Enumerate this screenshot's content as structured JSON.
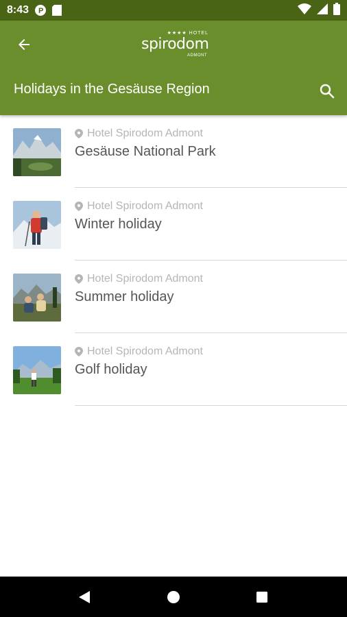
{
  "status_bar": {
    "time": "8:43",
    "icons": [
      "p-icon",
      "sd-card-icon",
      "wifi-icon",
      "signal-icon",
      "battery-icon"
    ]
  },
  "app_bar": {
    "logo": {
      "stars": "★★★★ HOTEL",
      "brand": "spirodom",
      "sub": "ADMONT"
    },
    "title": "Holidays in the Gesäuse Region",
    "back_icon": "arrow-left-icon",
    "search_icon": "search-icon"
  },
  "items": [
    {
      "location": "Hotel Spirodom Admont",
      "title": "Gesäuse National Park"
    },
    {
      "location": "Hotel Spirodom Admont",
      "title": "Winter holiday"
    },
    {
      "location": "Hotel Spirodom Admont",
      "title": "Summer holiday"
    },
    {
      "location": "Hotel Spirodom Admont",
      "title": "Golf holiday"
    }
  ],
  "nav_bar": {
    "buttons": [
      "back-triangle-icon",
      "home-circle-icon",
      "recents-square-icon"
    ]
  },
  "colors": {
    "status_bar": "#4a6415",
    "app_bar": "#6b8e2c",
    "secondary_text": "#b5b5b5",
    "primary_text": "#555555"
  }
}
